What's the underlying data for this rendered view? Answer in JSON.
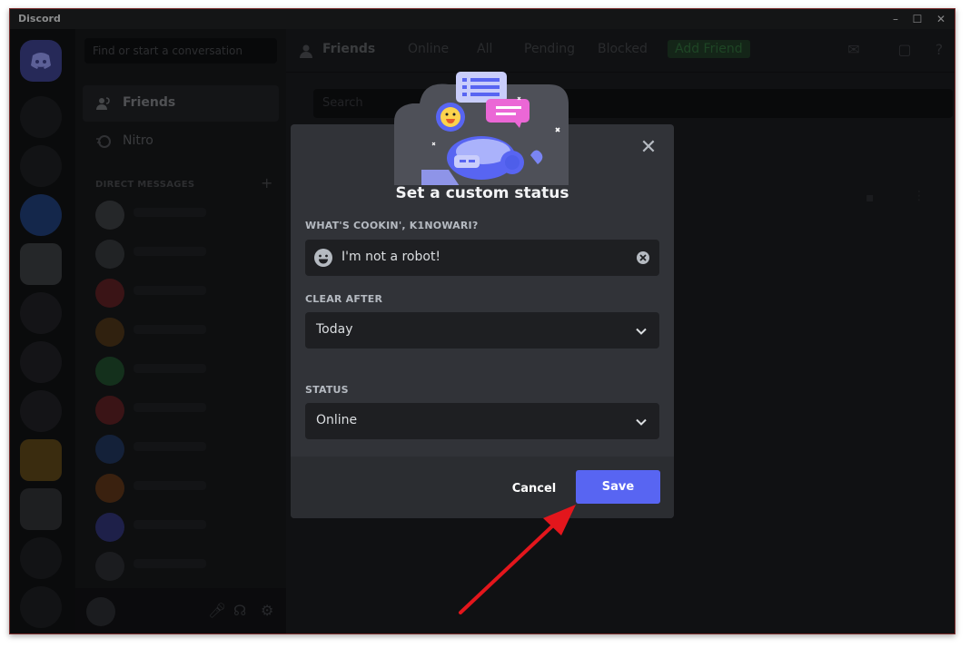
{
  "window": {
    "title": "Discord",
    "minimize_glyph": "–",
    "maximize_glyph": "☐",
    "close_glyph": "✕"
  },
  "sidebar": {
    "search_placeholder": "Find or start a conversation",
    "nav": [
      {
        "label": "Friends",
        "icon": "friends-icon"
      },
      {
        "label": "Nitro",
        "icon": "nitro-icon"
      }
    ],
    "dm_header": "DIRECT MESSAGES",
    "dm_add": "+"
  },
  "topbar": {
    "title": "Friends",
    "tabs": [
      "Online",
      "All",
      "Pending",
      "Blocked"
    ],
    "add_friend": "Add Friend"
  },
  "main": {
    "search_placeholder": "Search"
  },
  "modal": {
    "title": "Set a custom status",
    "close_glyph": "✕",
    "status_label": "WHAT'S COOKIN', K1NOWARI?",
    "status_value": "I'm not a robot!",
    "clear_after_label": "CLEAR AFTER",
    "clear_after_value": "Today",
    "status_select_label": "STATUS",
    "status_select_value": "Online",
    "cancel_label": "Cancel",
    "save_label": "Save"
  },
  "colors": {
    "brand": "#5865f2",
    "modal_bg": "#313338",
    "field_bg": "#1e1f22",
    "annotation_arrow": "#e3161c"
  }
}
